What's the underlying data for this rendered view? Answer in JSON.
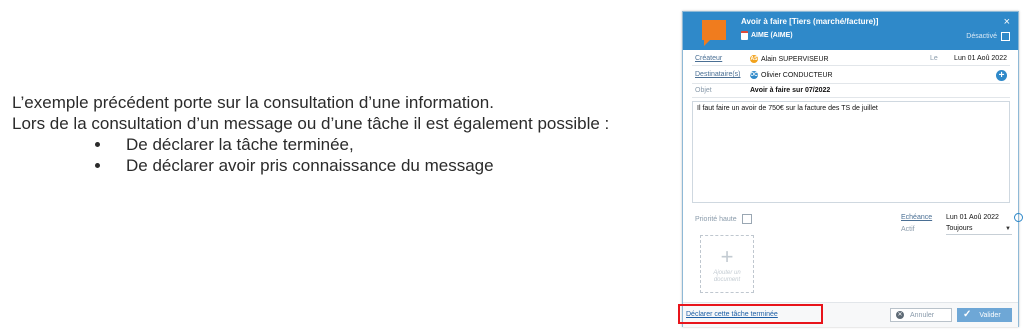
{
  "explanation": {
    "paragraph1": "L’exemple précédent porte sur la consultation d’une information.",
    "paragraph2": "Lors de la consultation d’un message ou d’une tâche il est également possible :",
    "bullets": [
      "De déclarer la tâche terminée,",
      "De déclarer avoir pris connaissance du message"
    ]
  },
  "dialog": {
    "title": "Avoir à faire [Tiers (marché/facture)]",
    "subtitle": "AIME (AIME)",
    "close": "×",
    "disabled_label": "Désactivé",
    "creator_label": "Créateur",
    "creator_initials": "AS",
    "creator_value": "Alain SUPERVISEUR",
    "date_label": "Le",
    "date_value": "Lun 01 Aoû 2022",
    "recipients_label": "Destinataire(s)",
    "recipient_initials": "OC",
    "recipient_value": "Olivier CONDUCTEUR",
    "add_recipient": "+",
    "object_label": "Objet",
    "object_value": "Avoir à faire sur 07/2022",
    "message": "Il faut faire un avoir de 750€ sur la facture des TS de juillet",
    "priority_label": "Priorité haute",
    "due_label": "Echéance",
    "due_value": "Lun 01 Aoû 2022",
    "active_label": "Actif",
    "active_value": "Toujours",
    "add_doc_plus": "+",
    "add_doc_label": "Ajouter un document",
    "declare_link": "Déclarer cette tâche terminée",
    "cancel_button": "Annuler",
    "ok_button": "Valider"
  },
  "colors": {
    "header": "#2f89c9",
    "accent": "#f07c1e",
    "highlight": "#e8141b"
  }
}
